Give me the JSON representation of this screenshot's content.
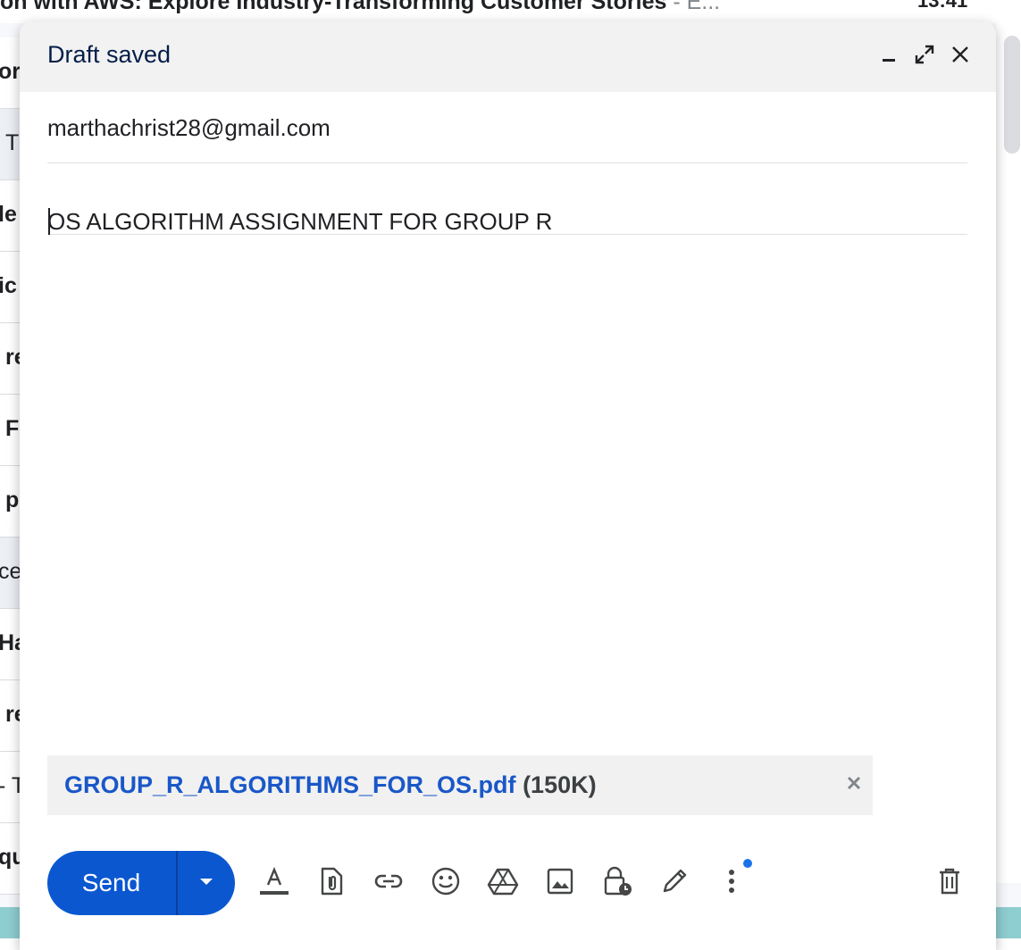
{
  "background": {
    "top_row": {
      "subject": "on with AWS: Explore Industry-Transforming Customer Stories",
      "snippet": " - E...",
      "time": "13:41"
    },
    "row_fragments": [
      "ork",
      "T",
      "le",
      "ic",
      "re",
      "F",
      "p",
      "ce",
      "Ha",
      "re",
      "- T",
      "qu"
    ]
  },
  "compose": {
    "title": "Draft saved",
    "header_buttons": {
      "minimize": "minimize-icon",
      "fullscreen": "expand-icon",
      "close": "close-icon"
    },
    "to": "marthachrist28@gmail.com",
    "subject": "OS ALGORITHM ASSIGNMENT FOR GROUP R",
    "body": "",
    "attachment": {
      "name": "GROUP_R_ALGORITHMS_FOR_OS.pdf",
      "size": "(150K)"
    },
    "send_label": "Send",
    "toolbar_icons": [
      "format-text-icon",
      "attach-file-icon",
      "insert-link-icon",
      "emoji-icon",
      "drive-icon",
      "insert-photo-icon",
      "confidential-mode-icon",
      "signature-icon",
      "more-options-icon"
    ],
    "discard_icon": "trash-icon"
  },
  "colors": {
    "accent": "#0b57d0",
    "attachment_link": "#1a57c8",
    "header_bg": "#f2f2f2",
    "notification_dot": "#1a73e8"
  }
}
